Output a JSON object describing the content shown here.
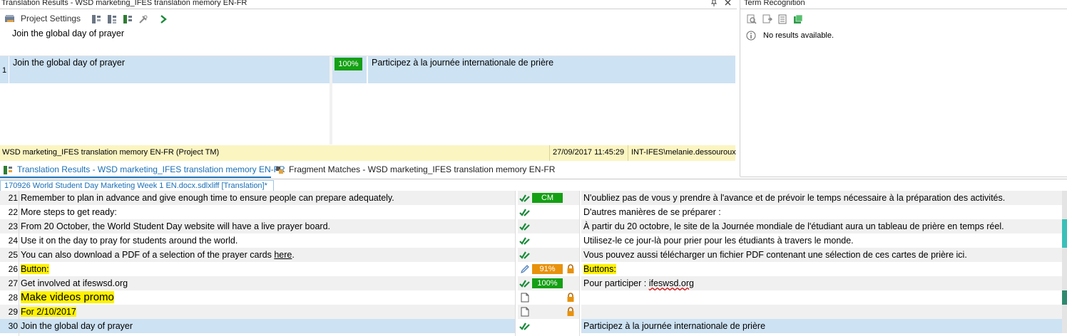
{
  "translation_results": {
    "title": "Translation Results - WSD marketing_IFES translation memory EN-FR",
    "toolbar": {
      "project_settings": "Project Settings"
    },
    "source_preview": "Join the global day of prayer",
    "match": {
      "row_number": "1",
      "source": "Join the global day of prayer",
      "score": "100%",
      "target": "Participez à la journée internationale de prière"
    },
    "status": {
      "tm_name": "WSD marketing_IFES translation memory EN-FR (Project TM)",
      "timestamp": "27/09/2017 11:45:29",
      "user": "INT-IFES\\melanie.dessouroux"
    }
  },
  "term_recognition": {
    "title": "Term Recognition",
    "message": "No results available."
  },
  "tabs": [
    {
      "label": "Translation Results - WSD marketing_IFES translation memory EN-FR"
    },
    {
      "label": "Fragment Matches - WSD marketing_IFES translation memory EN-FR"
    }
  ],
  "document_tab": "170926 World Student Day Marketing  Week 1 EN.docx.sdlxliff [Translation]*",
  "colors": {
    "accent_blue": "#1a6fb5",
    "row_selected": "#cde2f3",
    "match_green": "#14a014",
    "fuzzy_orange": "#e8920c",
    "highlight_yellow": "#fff200",
    "status_bar": "#fbf5c2"
  },
  "segments": [
    {
      "n": "21",
      "source": "Remember to plan in advance and give enough time to ensure people can prepare adequately.",
      "status_icon": "confirmed-check-icon",
      "badge": "CM",
      "badge_color": "green",
      "target": "N'oubliez pas de vous y prendre à l'avance et de prévoir le temps nécessaire à la préparation des activités."
    },
    {
      "n": "22",
      "source": "More steps to get ready:",
      "status_icon": "confirmed-check-icon",
      "badge": "",
      "target": "D'autres manières de se préparer :"
    },
    {
      "n": "23",
      "source": "From 20 October, the World Student Day website will have a live prayer board.",
      "status_icon": "confirmed-check-icon",
      "badge": "",
      "target": "À partir du 20 octobre, le site de la Journée mondiale de l'étudiant aura un tableau de prière en temps réel."
    },
    {
      "n": "24",
      "source": "Use it on the day to pray for students around the world.",
      "status_icon": "confirmed-check-icon",
      "badge": "",
      "target": "Utilisez-le ce jour-là pour prier pour les étudiants à travers le monde."
    },
    {
      "n": "25",
      "source_before": "You can also download a PDF of a selection of the prayer cards ",
      "source_link": "here",
      "source_after": ".",
      "status_icon": "confirmed-check-icon",
      "badge": "",
      "target": "Vous pouvez aussi télécharger un fichier PDF contenant une sélection de ces cartes de prière ici."
    },
    {
      "n": "26",
      "source": "Button:",
      "status_icon": "draft-pencil-icon",
      "badge": "91%",
      "badge_color": "orange",
      "lock": true,
      "target": "Buttons:"
    },
    {
      "n": "27",
      "source": "Get involved at ifeswsd.org",
      "status_icon": "confirmed-check-icon",
      "badge": "100%",
      "badge_color": "green",
      "target_before": "Pour participer : ",
      "target_link": "ifeswsd.org"
    },
    {
      "n": "28",
      "source": "Make videos promo",
      "status_icon": "not-translated-doc-icon",
      "lock": true,
      "target": ""
    },
    {
      "n": "29",
      "source": "For 2/10/2017",
      "status_icon": "not-translated-doc-icon",
      "lock": true,
      "target": ""
    },
    {
      "n": "30",
      "source": "Join the global day of prayer",
      "status_icon": "confirmed-check-icon",
      "badge": "",
      "target": "Participez à la journée internationale de prière"
    }
  ]
}
